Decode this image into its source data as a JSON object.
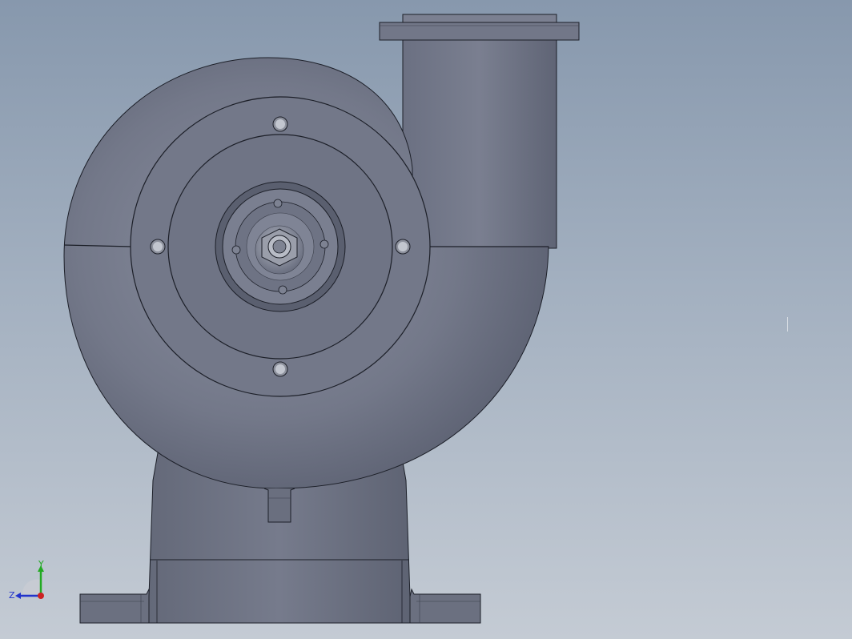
{
  "viewport": {
    "background_top": "#8798ad",
    "background_bottom": "#c4cbd4"
  },
  "model": {
    "part": "centrifugal-blower",
    "body_color": "#6f7485",
    "edge_color": "#1c1f28"
  },
  "triad": {
    "y_label": "Y",
    "z_label": "Z",
    "x_color": "#cc2222",
    "y_color": "#22aa22",
    "z_color": "#2233cc"
  }
}
